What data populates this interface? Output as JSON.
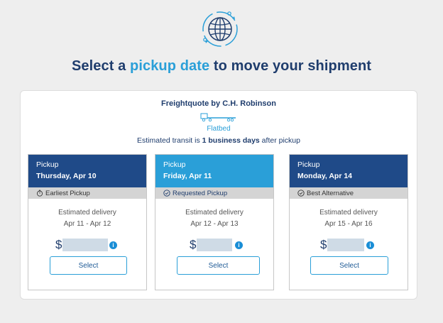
{
  "header": {
    "title_pre": "Select a ",
    "title_accent": "pickup date",
    "title_post": " to move your shipment",
    "icon": "globe-icon"
  },
  "quote": {
    "carrier": "Freightquote by C.H. Robinson",
    "equipment": "Flatbed",
    "equipment_icon": "flatbed-truck-icon",
    "transit_pre": "Estimated transit is ",
    "transit_bold": "1 business days",
    "transit_post": " after pickup"
  },
  "cards": [
    {
      "header_label": "Pickup",
      "date": "Thursday, Apr 10",
      "tag": "Earliest Pickup",
      "tag_icon": "stopwatch-icon",
      "est_label": "Estimated delivery",
      "est_range": "Apr 11 - Apr 12",
      "currency": "$",
      "select_label": "Select",
      "header_color": "#1f4a88"
    },
    {
      "header_label": "Pickup",
      "date": "Friday, Apr 11",
      "tag": "Requested Pickup",
      "tag_icon": "check-circle-icon",
      "est_label": "Estimated delivery",
      "est_range": "Apr 12 - Apr 13",
      "currency": "$",
      "select_label": "Select",
      "header_color": "#2a9fd8"
    },
    {
      "header_label": "Pickup",
      "date": "Monday, Apr 14",
      "tag": "Best Alternative",
      "tag_icon": "check-circle-icon",
      "est_label": "Estimated delivery",
      "est_range": "Apr 15 - Apr 16",
      "currency": "$",
      "select_label": "Select",
      "header_color": "#1f4a88"
    }
  ],
  "colors": {
    "navy": "#1f3d6d",
    "accent": "#2a9fd8",
    "tag_bg": "#d4d4d4",
    "info": "#1a8ed6"
  }
}
